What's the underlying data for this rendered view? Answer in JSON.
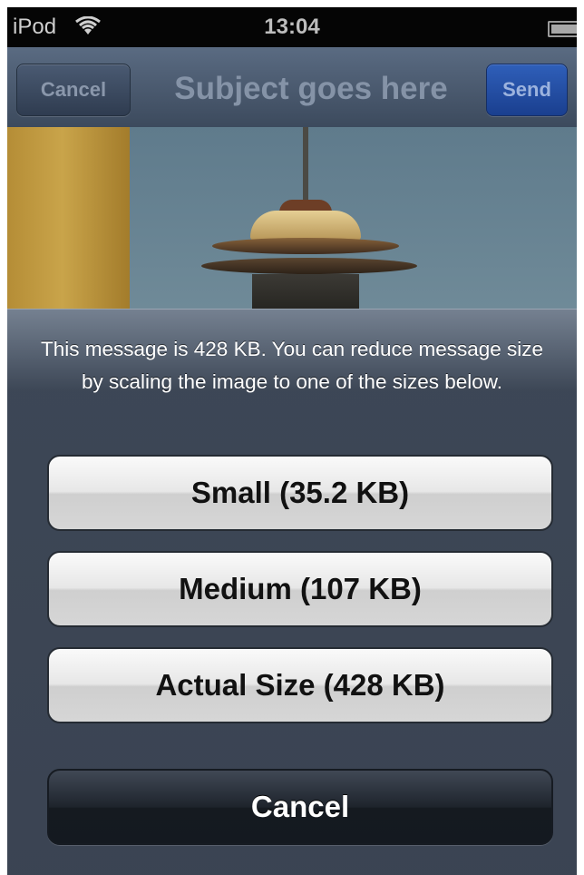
{
  "status_bar": {
    "carrier": "iPod",
    "time": "13:04"
  },
  "nav_bar": {
    "cancel_label": "Cancel",
    "title": "Subject goes here",
    "send_label": "Send"
  },
  "action_sheet": {
    "message": "This message is 428 KB. You can reduce message size by scaling the image to one of the sizes below.",
    "options": [
      {
        "label": "Small (35.2 KB)"
      },
      {
        "label": "Medium (107 KB)"
      },
      {
        "label": "Actual Size (428 KB)"
      }
    ],
    "cancel_label": "Cancel"
  }
}
